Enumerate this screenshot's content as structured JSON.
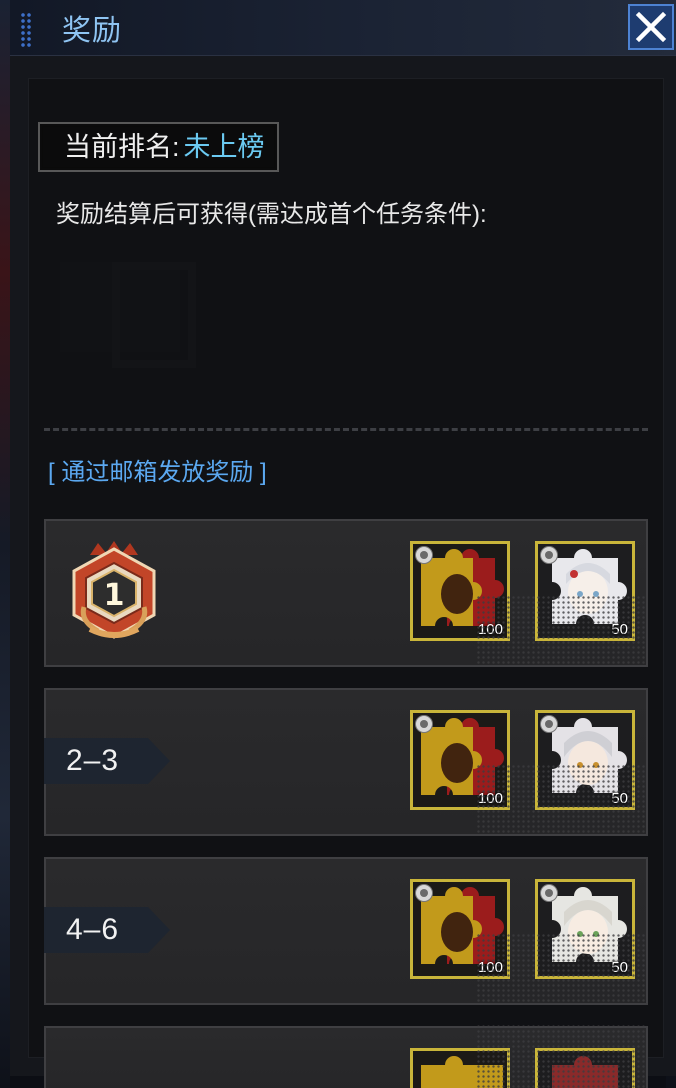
{
  "header": {
    "title": "奖励"
  },
  "rank": {
    "label": "当前排名:",
    "value": "未上榜"
  },
  "reward_note": "奖励结算后可获得(需达成首个任务条件):",
  "mail_notice": "[ 通过邮箱发放奖励 ]",
  "tiers": [
    {
      "rank": "1",
      "items": [
        {
          "name": "red-gold-puzzle-piece",
          "qty": "100"
        },
        {
          "name": "character-puzzle-piece",
          "qty": "50"
        }
      ]
    },
    {
      "rank": "2–3",
      "items": [
        {
          "name": "red-gold-puzzle-piece",
          "qty": "100"
        },
        {
          "name": "character-puzzle-piece",
          "qty": "50"
        }
      ]
    },
    {
      "rank": "4–6",
      "items": [
        {
          "name": "red-gold-puzzle-piece",
          "qty": "100"
        },
        {
          "name": "character-puzzle-piece",
          "qty": "50"
        }
      ]
    }
  ],
  "colors": {
    "accent_blue": "#6bcaf2",
    "item_border": "#c9b53a",
    "close_button": "#1e3c70"
  }
}
